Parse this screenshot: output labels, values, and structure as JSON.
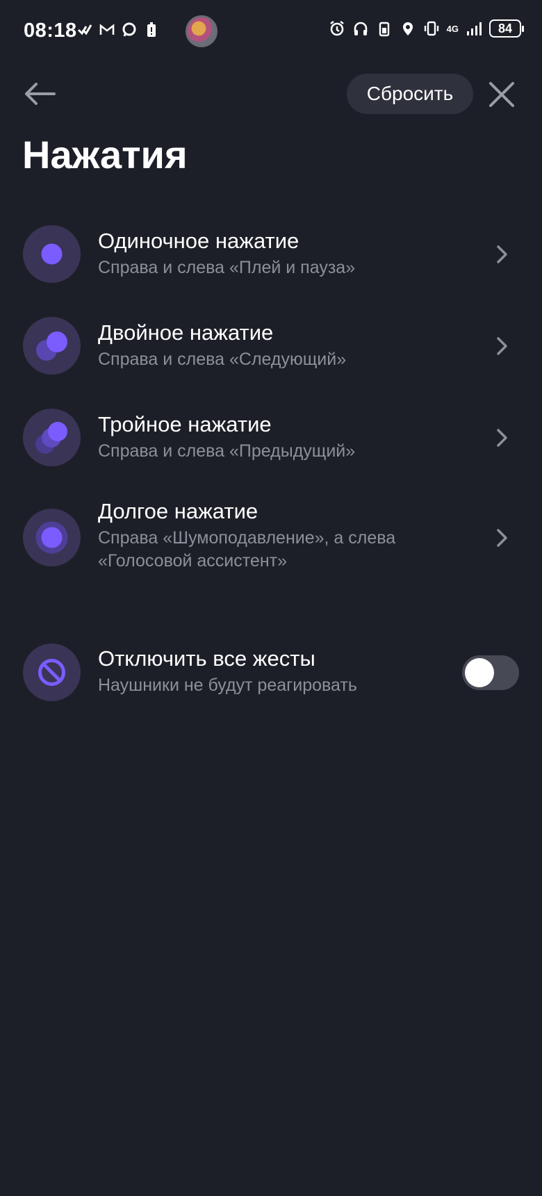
{
  "status_bar": {
    "time": "08:18",
    "network": "4G",
    "battery": "84",
    "left_icons": [
      "checkmark-app-icon",
      "gmail-icon",
      "chat-bubble-icon",
      "battery-alert-icon"
    ],
    "right_icons": [
      "alarm-icon",
      "headphones-icon",
      "headphone-battery-icon",
      "location-icon",
      "vibrate-icon",
      "signal-icon",
      "battery-icon"
    ]
  },
  "header": {
    "reset_label": "Сбросить",
    "title": "Нажатия"
  },
  "gestures": [
    {
      "icon": "single-tap-icon",
      "title": "Одиночное нажатие",
      "subtitle": "Справа и слева «Плей и пауза»"
    },
    {
      "icon": "double-tap-icon",
      "title": "Двойное нажатие",
      "subtitle": "Справа и слева «Следующий»"
    },
    {
      "icon": "triple-tap-icon",
      "title": "Тройное нажатие",
      "subtitle": "Справа и слева «Предыдущий»"
    },
    {
      "icon": "long-press-icon",
      "title": "Долгое нажатие",
      "subtitle_line1": "Справа «Шумоподавление», а слева",
      "subtitle_line2": "«Голосовой ассистент»"
    }
  ],
  "disable_all": {
    "icon": "disable-icon",
    "title": "Отключить все жесты",
    "subtitle": "Наушники не будут реагировать",
    "enabled": false
  },
  "colors": {
    "background": "#1d1f28",
    "accent": "#7b5cff",
    "icon_circle": "#3a3456",
    "secondary_text": "#8d8f99",
    "button_bg": "#2f323c"
  }
}
